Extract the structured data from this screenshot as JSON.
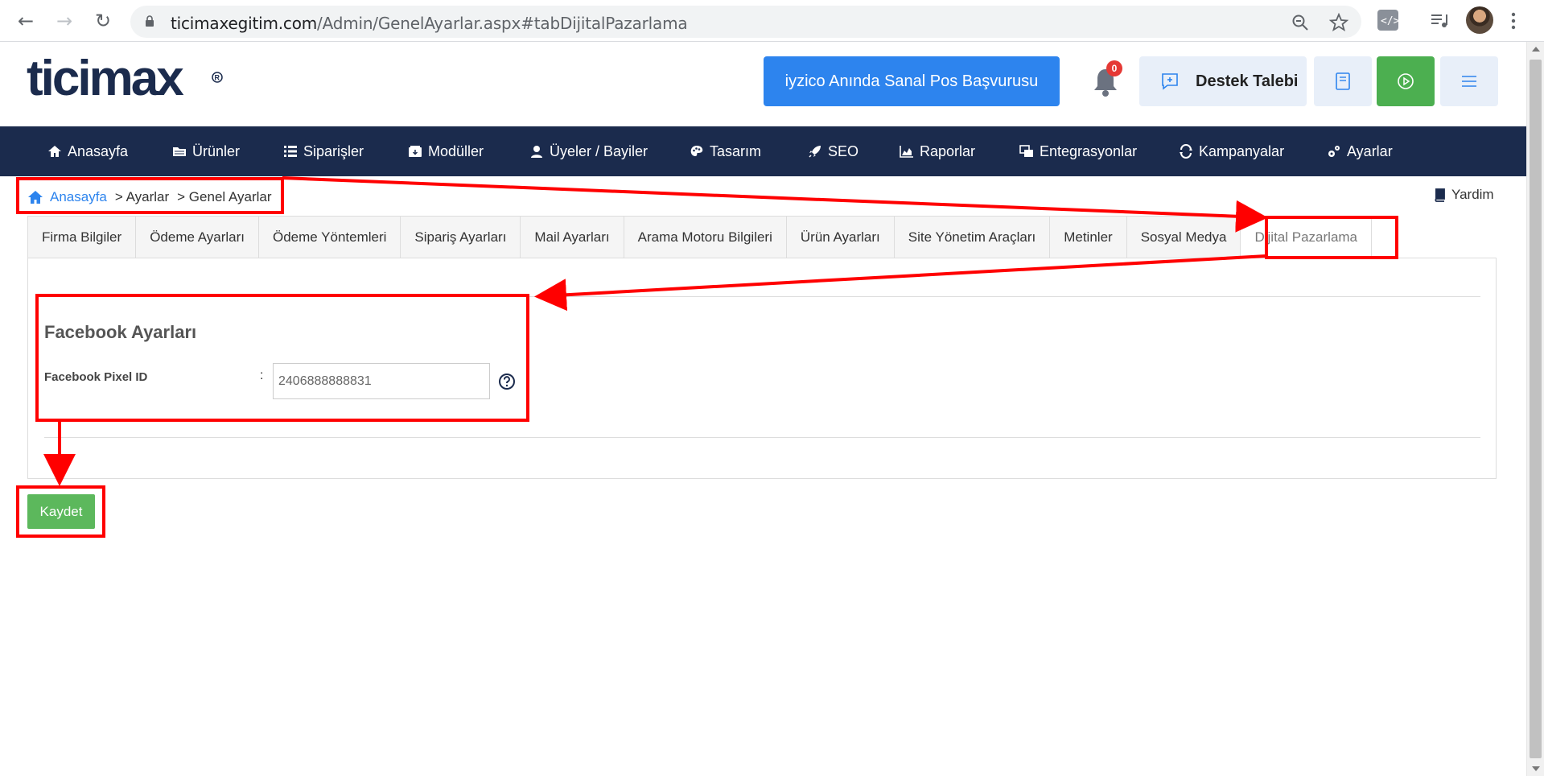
{
  "browser": {
    "url_host": "ticimaxegitim.com",
    "url_path": "/Admin/GenelAyarlar.aspx#tabDijitalPazarlama",
    "icons": [
      "back-icon",
      "forward-icon",
      "reload-icon",
      "lock-icon",
      "zoom-icon",
      "star-icon",
      "extension-icon",
      "media-icon",
      "avatar",
      "menu-icon"
    ]
  },
  "header": {
    "logo_text": "ticimax",
    "iyzico_label": "iyzico Anında Sanal Pos Başvurusu",
    "notification_count": "0",
    "support_label": "Destek Talebi"
  },
  "mainnav": {
    "items": [
      {
        "label": "Anasayfa",
        "icon": "home-icon"
      },
      {
        "label": "Ürünler",
        "icon": "folder-icon"
      },
      {
        "label": "Siparişler",
        "icon": "list-icon"
      },
      {
        "label": "Modüller",
        "icon": "box-icon"
      },
      {
        "label": "Üyeler / Bayiler",
        "icon": "user-icon"
      },
      {
        "label": "Tasarım",
        "icon": "palette-icon"
      },
      {
        "label": "SEO",
        "icon": "rocket-icon"
      },
      {
        "label": "Raporlar",
        "icon": "chart-icon"
      },
      {
        "label": "Entegrasyonlar",
        "icon": "windows-icon"
      },
      {
        "label": "Kampanyalar",
        "icon": "cycle-icon"
      },
      {
        "label": "Ayarlar",
        "icon": "gears-icon"
      }
    ]
  },
  "breadcrumb": {
    "home": "Anasayfa",
    "level1": "> Ayarlar",
    "level2": "> Genel Ayarlar"
  },
  "help_label": "Yardim",
  "tabs": [
    "Firma Bilgiler",
    "Ödeme Ayarları",
    "Ödeme Yöntemleri",
    "Sipariş Ayarları",
    "Mail Ayarları",
    "Arama Motoru Bilgileri",
    "Ürün Ayarları",
    "Site Yönetim Araçları",
    "Metinler",
    "Sosyal Medya",
    "Dijital Pazarlama"
  ],
  "active_tab": "Dijital Pazarlama",
  "facebook": {
    "title": "Facebook Ayarları",
    "pixel_label": "Facebook Pixel ID",
    "colon": ":",
    "pixel_value": "2406888888831"
  },
  "save_label": "Kaydet",
  "colors": {
    "nav_bg": "#1b2b4d",
    "primary_blue": "#2d84ee",
    "success_green": "#5cb85c",
    "annotation_red": "#ff0000"
  }
}
